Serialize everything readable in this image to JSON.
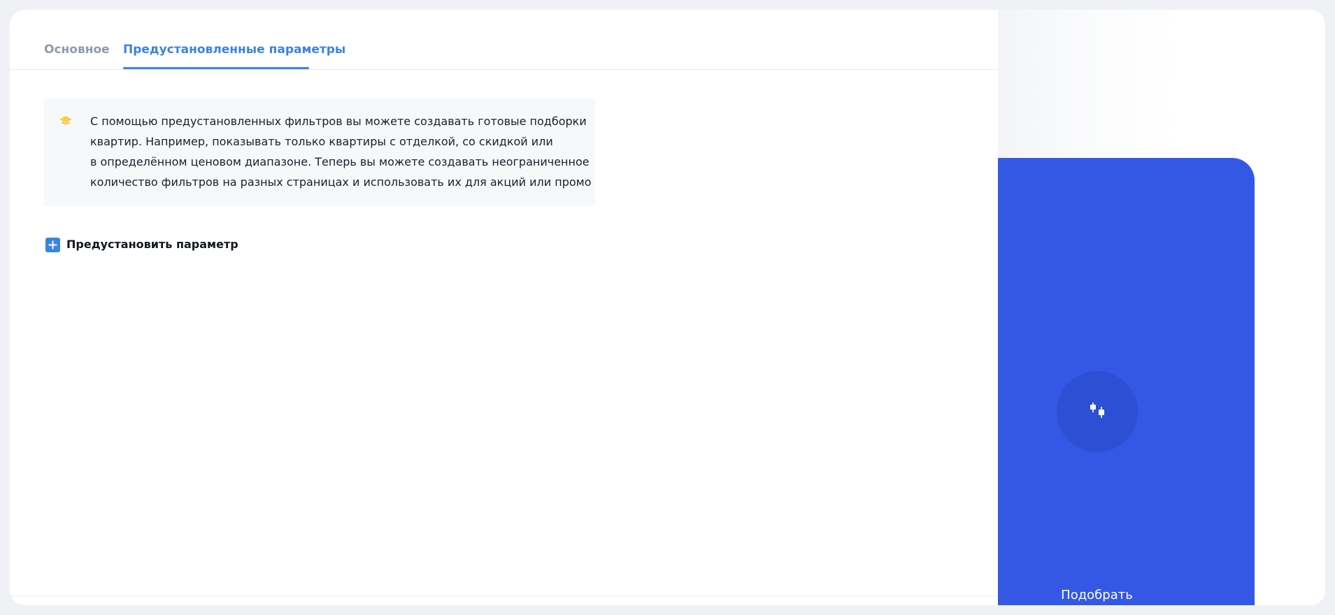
{
  "tabs": [
    {
      "label": "Основное",
      "active": false
    },
    {
      "label": "Предустановленные параметры",
      "active": true
    }
  ],
  "notice": {
    "icon": "graduation-cap-icon",
    "icon_color": "#f5cf45",
    "lines": [
      "С помощью предустановленных фильтров вы можете создавать готовые подборки",
      "квартир. Например, показывать только квартиры с отделкой, со скидкой или",
      "в определённом ценовом диапазоне. Теперь вы можете создавать неограниченное",
      "количество фильтров на разных страницах и использовать их для акций или промо"
    ]
  },
  "add_param": {
    "icon": "plus-square-icon",
    "label": "Предустановить параметр"
  },
  "preview": {
    "widget_color": "#3458e5",
    "icon": "filter-sliders-icon",
    "label": "Подобрать"
  },
  "colors": {
    "accent": "#3a83e6",
    "inactive_tab": "#8e9aad",
    "notice_bg": "#f6f8fa"
  }
}
